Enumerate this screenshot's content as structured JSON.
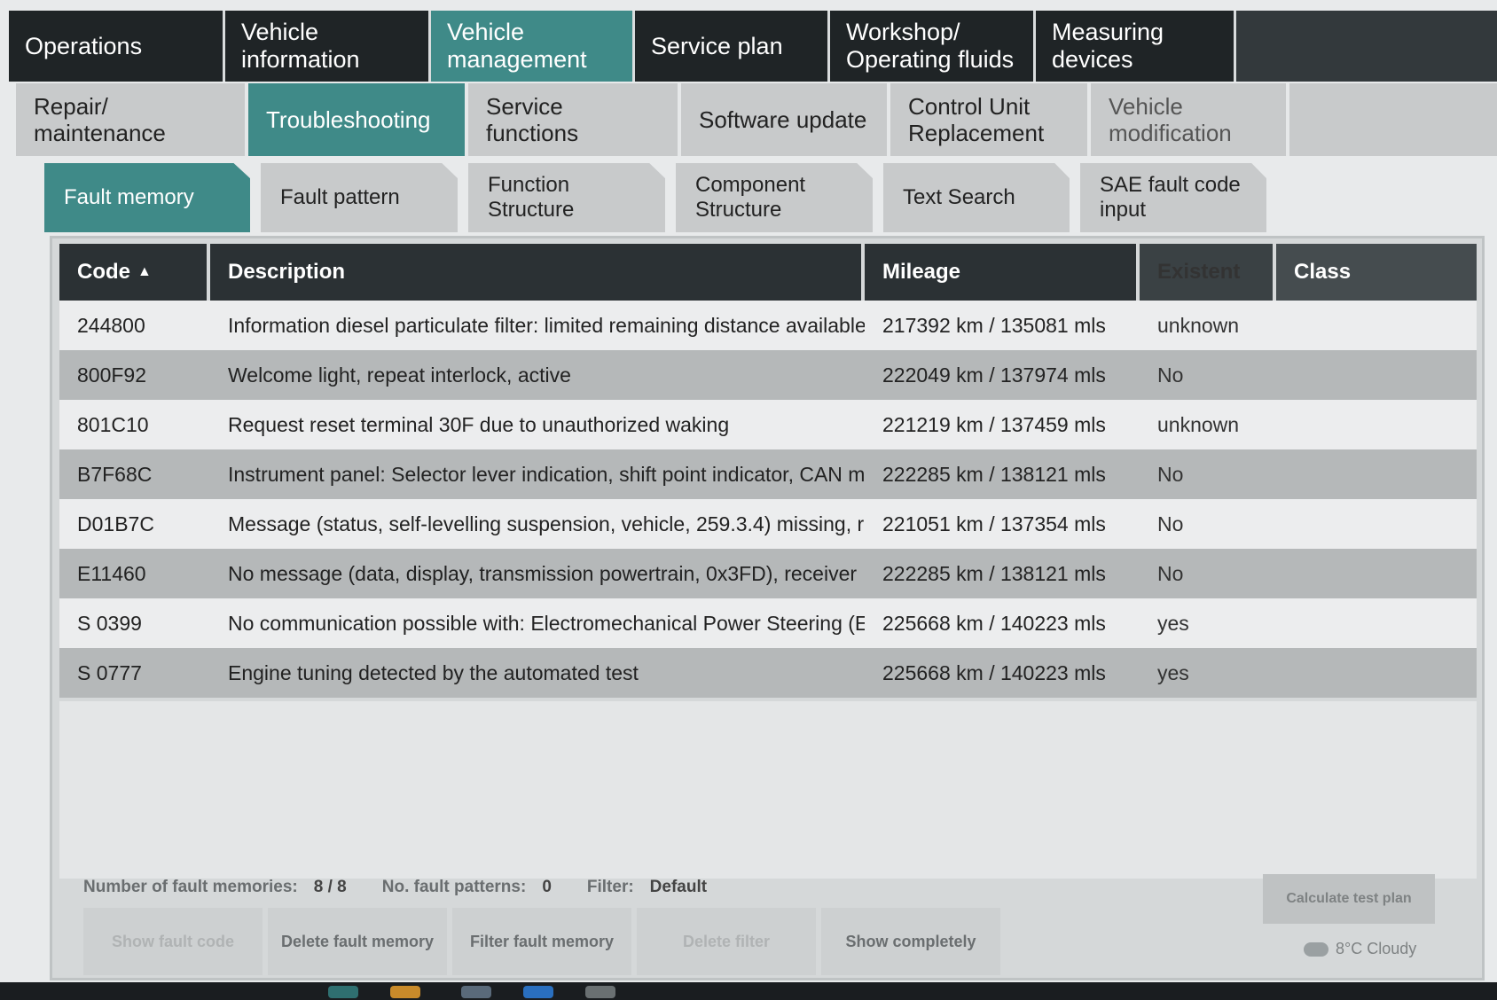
{
  "nav_main": [
    {
      "label": "Operations",
      "active": false
    },
    {
      "label": "Vehicle information",
      "active": false
    },
    {
      "label": "Vehicle management",
      "active": true
    },
    {
      "label": "Service plan",
      "active": false
    },
    {
      "label": "Workshop/ Operating fluids",
      "active": false
    },
    {
      "label": "Measuring devices",
      "active": false
    }
  ],
  "nav_sub": [
    {
      "label": "Repair/ maintenance",
      "active": false
    },
    {
      "label": "Troubleshooting",
      "active": true
    },
    {
      "label": "Service functions",
      "active": false
    },
    {
      "label": "Software update",
      "active": false
    },
    {
      "label": "Control Unit Replacement",
      "active": false
    },
    {
      "label": "Vehicle modification",
      "active": false
    }
  ],
  "nav_tabs": [
    {
      "label": "Fault memory",
      "active": true
    },
    {
      "label": "Fault pattern",
      "active": false
    },
    {
      "label": "Function Structure",
      "active": false
    },
    {
      "label": "Component Structure",
      "active": false
    },
    {
      "label": "Text Search",
      "active": false
    },
    {
      "label": "SAE fault code input",
      "active": false
    }
  ],
  "table": {
    "columns": [
      "Code",
      "Description",
      "Mileage",
      "Existent",
      "Class"
    ],
    "sort_indicator": "▲",
    "rows": [
      {
        "code": "244800",
        "description": "Information diesel particulate filter: limited remaining distance available",
        "mileage": "217392 km / 135081 mls",
        "existent": "unknown",
        "class": ""
      },
      {
        "code": "800F92",
        "description": "Welcome light, repeat interlock, active",
        "mileage": "222049 km / 137974 mls",
        "existent": "No",
        "class": ""
      },
      {
        "code": "801C10",
        "description": "Request reset terminal 30F due to unauthorized waking",
        "mileage": "221219 km / 137459 mls",
        "existent": "unknown",
        "class": ""
      },
      {
        "code": "B7F68C",
        "description": "Instrument panel: Selector lever indication, shift point indicator, CAN m",
        "mileage": "222285 km / 138121 mls",
        "existent": "No",
        "class": ""
      },
      {
        "code": "D01B7C",
        "description": "Message (status, self-levelling suspension, vehicle, 259.3.4) missing, r",
        "mileage": "221051 km / 137354 mls",
        "existent": "No",
        "class": ""
      },
      {
        "code": "E11460",
        "description": "No message (data, display, transmission powertrain, 0x3FD), receiver",
        "mileage": "222285 km / 138121 mls",
        "existent": "No",
        "class": ""
      },
      {
        "code": "S 0399",
        "description": "No communication possible with: Electromechanical Power Steering (E",
        "mileage": "225668 km / 140223 mls",
        "existent": "yes",
        "class": ""
      },
      {
        "code": "S 0777",
        "description": "Engine tuning detected by the automated test",
        "mileage": "225668 km / 140223 mls",
        "existent": "yes",
        "class": ""
      }
    ]
  },
  "status": {
    "fault_memories_label": "Number of fault memories:",
    "fault_memories_value": "8 / 8",
    "fault_patterns_label": "No. fault patterns:",
    "fault_patterns_value": "0",
    "filter_label": "Filter:",
    "filter_value": "Default"
  },
  "buttons": {
    "show_fault_code": "Show fault code",
    "delete_fault_memory": "Delete fault memory",
    "filter_fault_memory": "Filter fault memory",
    "delete_filter": "Delete filter",
    "show_completely": "Show completely",
    "calculate_test_plan": "Calculate test plan"
  },
  "weather": {
    "text": "8°C Cloudy"
  },
  "colors": {
    "accent": "#3f8a88",
    "dark": "#1f2426"
  }
}
